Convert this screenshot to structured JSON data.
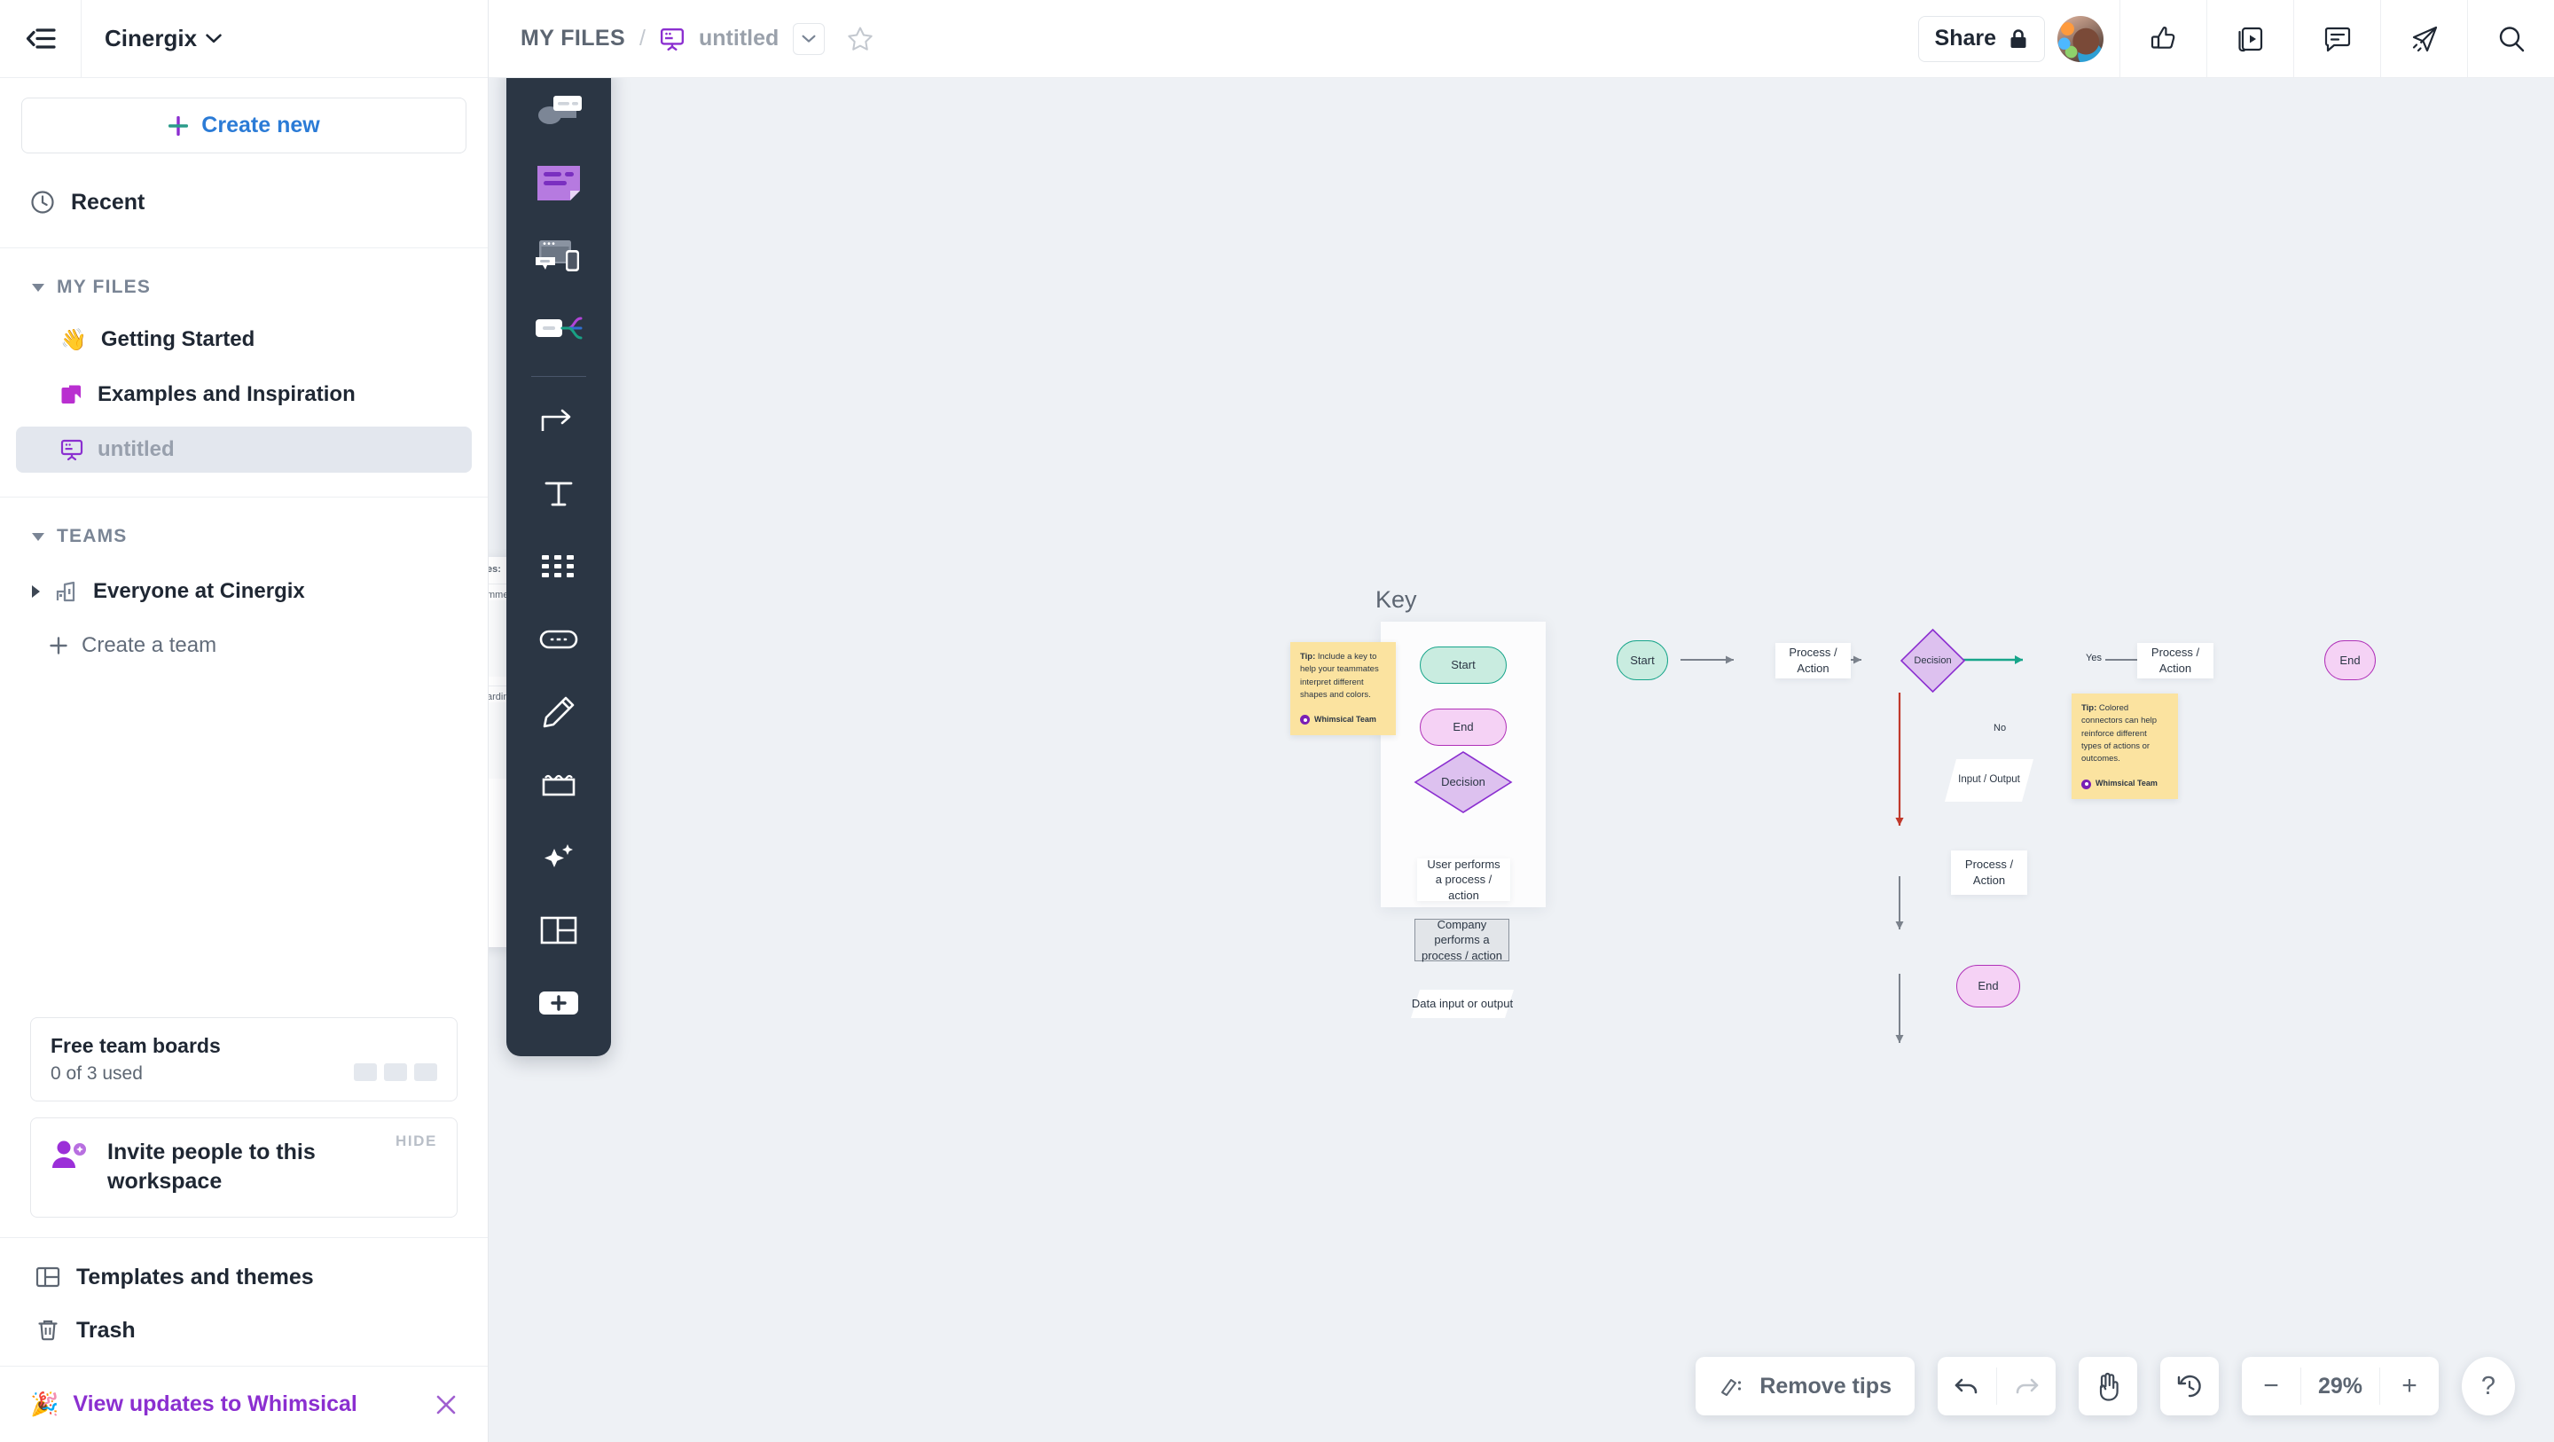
{
  "sidebar": {
    "workspace_name": "Cinergix",
    "collapse_icon": "collapse-sidebar-icon",
    "create_new_label": "Create new",
    "recent_label": "Recent",
    "my_files_label": "MY FILES",
    "files": [
      {
        "label": "Getting Started",
        "icon": "wave-emoji",
        "emoji": "👋",
        "active": false
      },
      {
        "label": "Examples and Inspiration",
        "icon": "folder-icon",
        "active": false
      },
      {
        "label": "untitled",
        "icon": "board-icon",
        "active": true
      }
    ],
    "teams_label": "TEAMS",
    "team_item": "Everyone at Cinergix",
    "create_team_label": "Create a team",
    "free_boards": {
      "title": "Free team boards",
      "subtitle": "0 of 3 used",
      "pips": 3
    },
    "invite": {
      "title": "Invite people to this workspace",
      "hide_label": "HIDE"
    },
    "bottom_links": [
      {
        "label": "Templates and themes",
        "icon": "templates-icon"
      },
      {
        "label": "Trash",
        "icon": "trash-icon"
      }
    ],
    "updates": {
      "label": "View updates to Whimsical",
      "emoji": "🎉"
    }
  },
  "topbar": {
    "breadcrumb_root": "MY FILES",
    "breadcrumb_sep": "/",
    "breadcrumb_title": "untitled",
    "share_label": "Share",
    "icons": [
      "thumbs-up-icon",
      "present-icon",
      "comment-icon",
      "send-icon",
      "search-icon"
    ]
  },
  "toolbar": {
    "items": [
      {
        "name": "flowchart-tool"
      },
      {
        "name": "sticky-note-tool"
      },
      {
        "name": "wireframe-tool"
      },
      {
        "name": "mindmap-tool"
      },
      {
        "name": "connector-tool"
      },
      {
        "name": "text-tool"
      },
      {
        "name": "shapes-tool"
      },
      {
        "name": "link-tool"
      },
      {
        "name": "pen-tool"
      },
      {
        "name": "highlighter-tool"
      },
      {
        "name": "ai-tool"
      },
      {
        "name": "template-tool"
      },
      {
        "name": "add-tool"
      }
    ]
  },
  "canvas": {
    "key_title": "Key",
    "key_items": [
      {
        "label": "Start",
        "shape": "terminator",
        "fill": "#c9ece0",
        "stroke": "#17a58a"
      },
      {
        "label": "End",
        "shape": "terminator",
        "fill": "#f5d2f5",
        "stroke": "#b030b8"
      },
      {
        "label": "Decision",
        "shape": "diamond",
        "fill": "#ddc1ef",
        "stroke": "#8b2fd0"
      },
      {
        "label": "User performs a process / action",
        "shape": "rect",
        "fill": "#ffffff",
        "stroke": "none"
      },
      {
        "label": "Company performs a process / action",
        "shape": "rect",
        "fill": "#e2e5e9",
        "stroke": "#8a929c"
      },
      {
        "label": "Data input or output",
        "shape": "parallelogram",
        "fill": "#ffffff",
        "stroke": "none"
      }
    ],
    "tips": [
      {
        "name": "tip-key",
        "prefix": "Tip:",
        "text": " Include a key to help your teammates interpret different shapes and colors.",
        "author": "Whimsical Team"
      },
      {
        "name": "tip-connectors",
        "prefix": "Tip:",
        "text": " Colored connectors can help reinforce different types of actions or outcomes.",
        "author": "Whimsical Team"
      }
    ],
    "flow_nodes": [
      {
        "id": "n1",
        "label": "Start",
        "shape": "terminator",
        "fill": "#c9ece0",
        "stroke": "#17a58a"
      },
      {
        "id": "n2",
        "label": "Process / Action",
        "shape": "rect",
        "fill": "#ffffff"
      },
      {
        "id": "n3",
        "label": "Decision",
        "shape": "diamond",
        "fill": "#ddc1ef",
        "stroke": "#8b2fd0"
      },
      {
        "id": "n4",
        "label": "Process / Action",
        "shape": "rect",
        "fill": "#ffffff"
      },
      {
        "id": "n5",
        "label": "End",
        "shape": "terminator",
        "fill": "#f5d2f5",
        "stroke": "#b030b8"
      },
      {
        "id": "n6",
        "label": "Input / Output",
        "shape": "parallelogram",
        "fill": "#ffffff"
      },
      {
        "id": "n7",
        "label": "Process / Action",
        "shape": "rect",
        "fill": "#ffffff"
      },
      {
        "id": "n8",
        "label": "End",
        "shape": "terminator",
        "fill": "#f5d2f5",
        "stroke": "#b030b8"
      }
    ],
    "edge_labels": {
      "yes": "Yes",
      "no": "No"
    },
    "edge_colors": {
      "default": "#7b828c",
      "yes": "#17a58a",
      "no": "#c0392b"
    }
  },
  "bottombar": {
    "remove_tips_label": "Remove tips",
    "zoom_level": "29%",
    "help_label": "?",
    "undo_icon": "undo-icon",
    "redo_icon": "redo-icon",
    "hand_icon": "hand-tool-icon",
    "history_icon": "history-icon",
    "zoom_out_label": "−",
    "zoom_in_label": "+"
  }
}
